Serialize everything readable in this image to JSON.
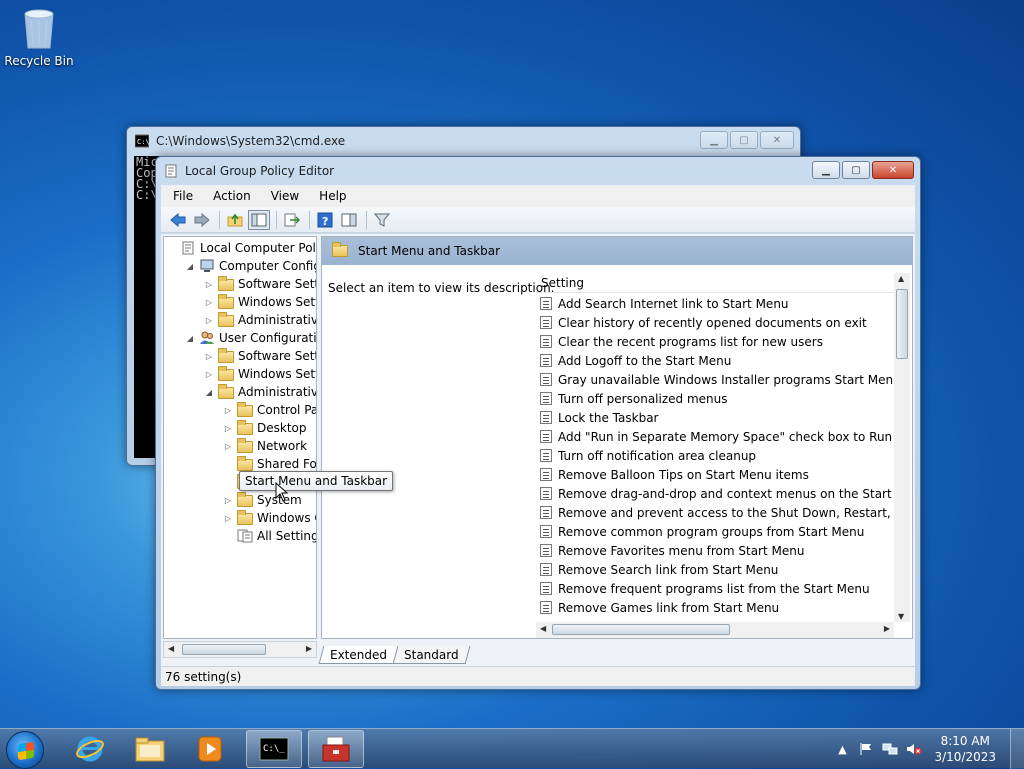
{
  "desktop": {
    "recycle_bin_label": "Recycle Bin"
  },
  "cmd": {
    "title": "C:\\Windows\\System32\\cmd.exe",
    "lines": [
      "Mic",
      "Cop",
      "",
      "C:\\",
      "",
      "C:\\"
    ]
  },
  "gpe": {
    "title": "Local Group Policy Editor",
    "menu": [
      "File",
      "Action",
      "View",
      "Help"
    ],
    "tree": [
      {
        "label": "Local Computer Policy",
        "indent": 0,
        "expander": "",
        "icon": "policy"
      },
      {
        "label": "Computer Configura",
        "indent": 1,
        "expander": "◢",
        "icon": "computer"
      },
      {
        "label": "Software Settings",
        "indent": 2,
        "expander": "▷",
        "icon": "folder"
      },
      {
        "label": "Windows Setting",
        "indent": 2,
        "expander": "▷",
        "icon": "folder"
      },
      {
        "label": "Administrative Te",
        "indent": 2,
        "expander": "▷",
        "icon": "folder"
      },
      {
        "label": "User Configuration",
        "indent": 1,
        "expander": "◢",
        "icon": "user"
      },
      {
        "label": "Software Settings",
        "indent": 2,
        "expander": "▷",
        "icon": "folder"
      },
      {
        "label": "Windows Setting",
        "indent": 2,
        "expander": "▷",
        "icon": "folder"
      },
      {
        "label": "Administrative Te",
        "indent": 2,
        "expander": "◢",
        "icon": "folder"
      },
      {
        "label": "Control Panel",
        "indent": 3,
        "expander": "▷",
        "icon": "folder"
      },
      {
        "label": "Desktop",
        "indent": 3,
        "expander": "▷",
        "icon": "folder"
      },
      {
        "label": "Network",
        "indent": 3,
        "expander": "▷",
        "icon": "folder"
      },
      {
        "label": "Shared Folder",
        "indent": 3,
        "expander": "",
        "icon": "folder"
      },
      {
        "label": "Start Menu and Taskbar",
        "indent": 3,
        "expander": "",
        "icon": "folder"
      },
      {
        "label": "System",
        "indent": 3,
        "expander": "▷",
        "icon": "folder"
      },
      {
        "label": "Windows Cor",
        "indent": 3,
        "expander": "▷",
        "icon": "folder"
      },
      {
        "label": "All Settings",
        "indent": 3,
        "expander": "",
        "icon": "allsettings"
      }
    ],
    "pane_header": "Start Menu and Taskbar",
    "description": "Select an item to view its description.",
    "column_header": "Setting",
    "settings": [
      "Add Search Internet link to Start Menu",
      "Clear history of recently opened documents on exit",
      "Clear the recent programs list for new users",
      "Add Logoff to the Start Menu",
      "Gray unavailable Windows Installer programs Start Menu sh...",
      "Turn off personalized menus",
      "Lock the Taskbar",
      "Add \"Run in Separate Memory Space\" check box to Run dial...",
      "Turn off notification area cleanup",
      "Remove Balloon Tips on Start Menu items",
      "Remove drag-and-drop and context menus on the Start Me...",
      "Remove and prevent access to the Shut Down, Restart, Sleep...",
      "Remove common program groups from Start Menu",
      "Remove Favorites menu from Start Menu",
      "Remove Search link from Start Menu",
      "Remove frequent programs list from the Start Menu",
      "Remove Games link from Start Menu"
    ],
    "tabs": [
      "Extended",
      "Standard"
    ],
    "status": "76 setting(s)",
    "tooltip": "Start Menu and Taskbar"
  },
  "taskbar": {
    "clock_time": "8:10 AM",
    "clock_date": "3/10/2023"
  }
}
